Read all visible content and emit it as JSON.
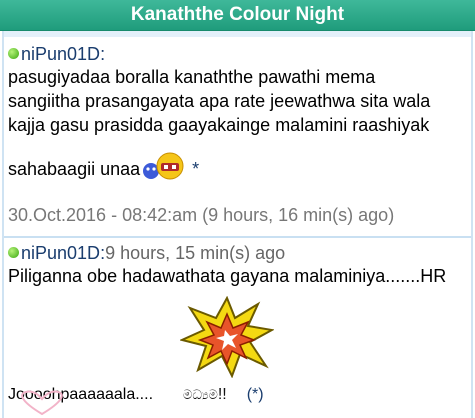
{
  "header": {
    "title": "Kanaththe Colour Night"
  },
  "posts": [
    {
      "user": "niPun01D",
      "colon": ":",
      "text_line1": "pasugiyadaa boralla kanaththe pawathi mema",
      "text_line2": "sangiitha prasangayata apa rate jeewathwa sita wala",
      "text_line3": "kajja gasu prasidda gaayakainge malamini raashiyak",
      "text_line4": "sahabaagii unaa",
      "link": "*",
      "timestamp": "30.Oct.2016 - 08:42:am (9 hours, 16 min(s) ago)"
    },
    {
      "user": "niPun01D",
      "colon": ":",
      "reltime": "9 hours, 15 min(s) ago",
      "text_line1": "Piliganna obe hadawathata gayana malaminiya.......HR",
      "sign_text": "Joooohpaaaaaala....",
      "sinhala": "මධ්‍යම",
      "exclaim": "!!",
      "link": "(*)"
    }
  ],
  "colors": {
    "header_bg": "#1f9c7c",
    "username": "#1a3d6e",
    "timestamp": "#777777"
  }
}
